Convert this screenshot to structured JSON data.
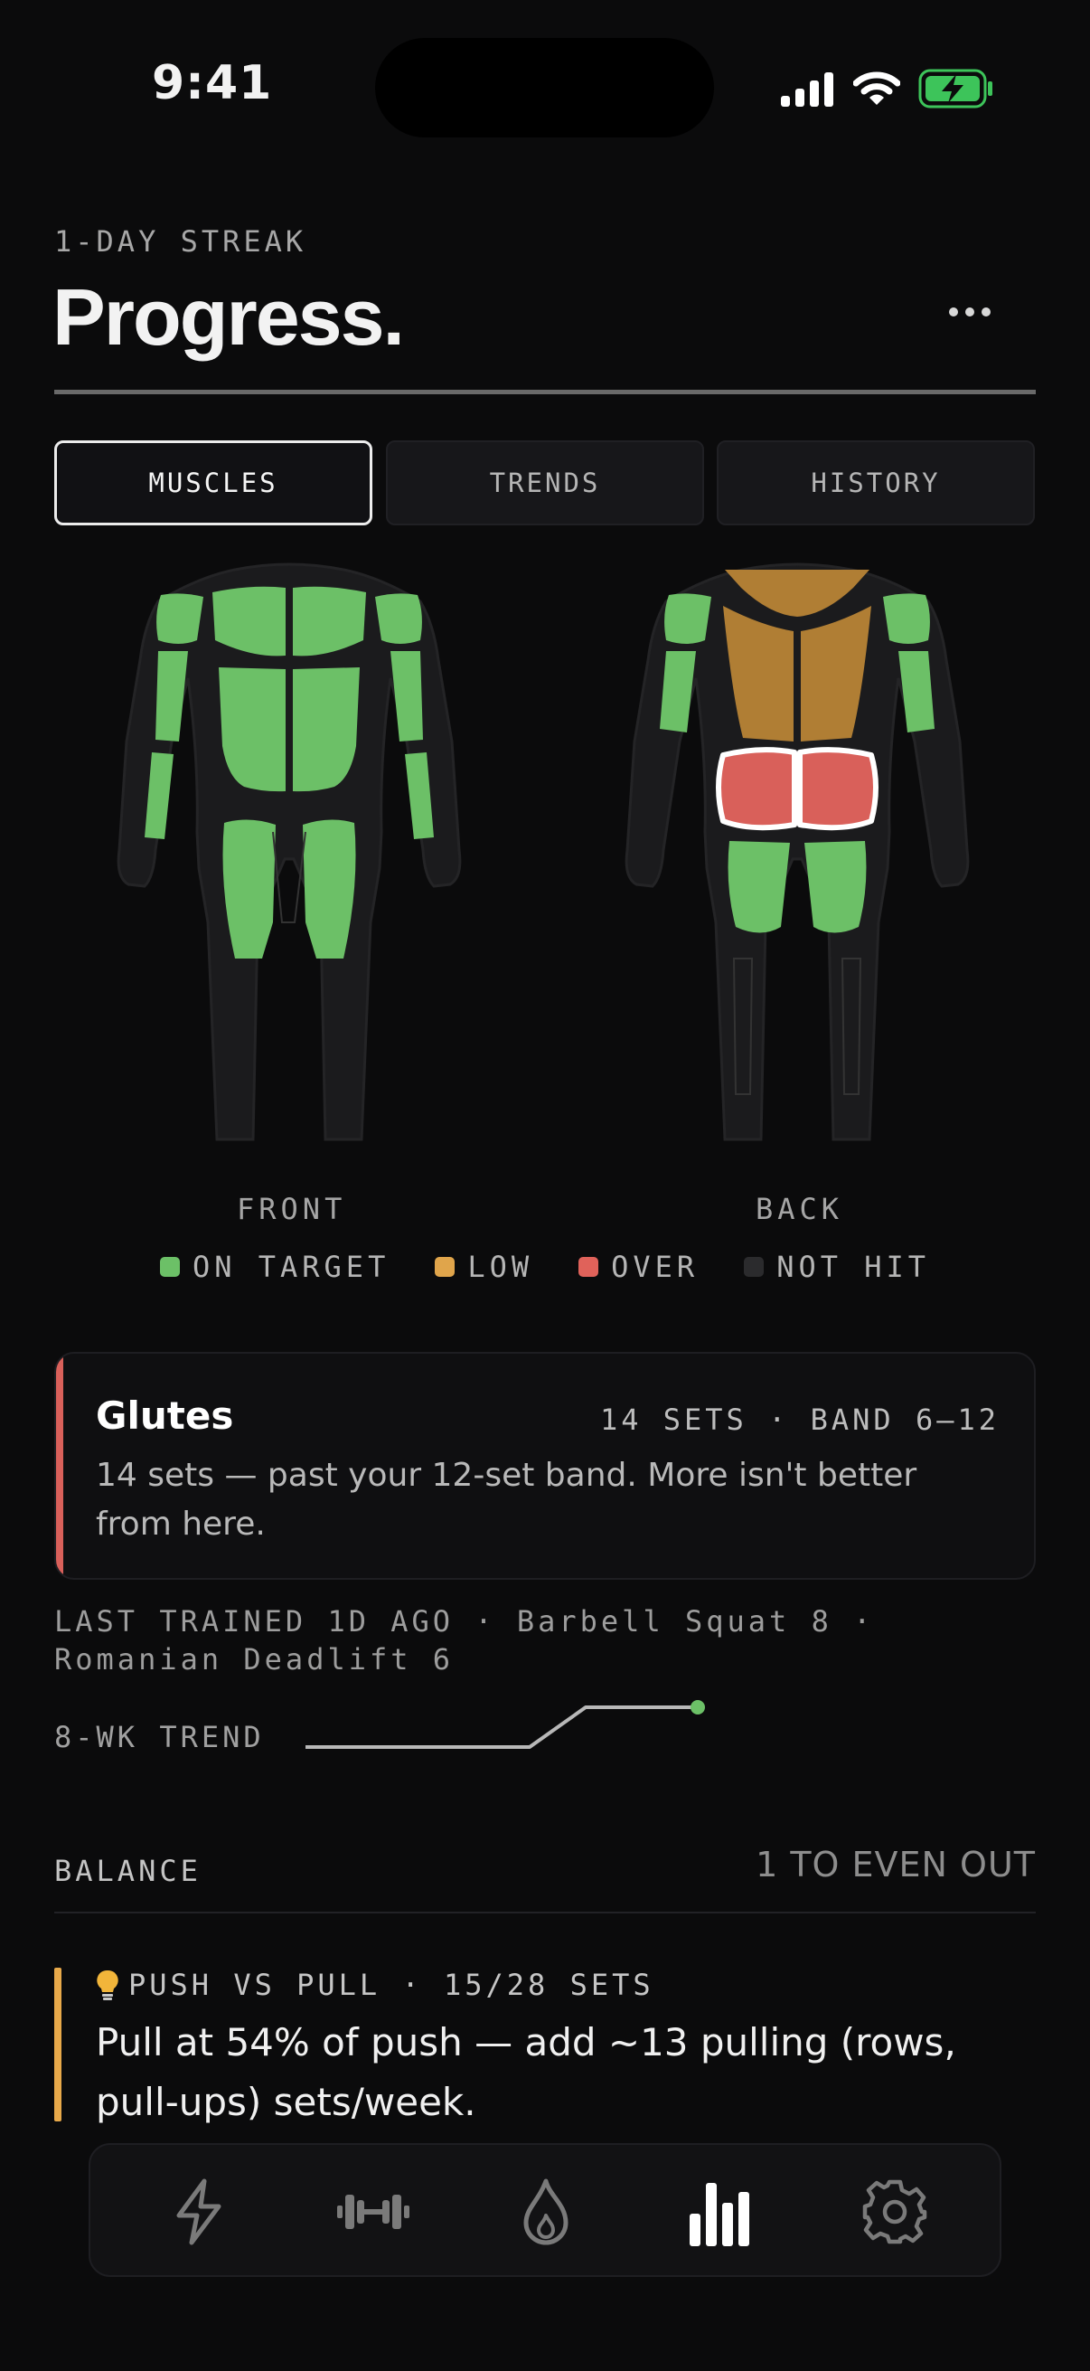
{
  "status": {
    "time": "9:41"
  },
  "header": {
    "streak": "1-DAY STREAK",
    "title": "Progress."
  },
  "tabs": [
    {
      "label": "MUSCLES",
      "active": true
    },
    {
      "label": "TRENDS",
      "active": false
    },
    {
      "label": "HISTORY",
      "active": false
    }
  ],
  "figures": {
    "front_label": "FRONT",
    "back_label": "BACK"
  },
  "legend": [
    {
      "label": "ON TARGET",
      "color": "#6cc067"
    },
    {
      "label": "LOW",
      "color": "#e0a54b"
    },
    {
      "label": "OVER",
      "color": "#e0625a"
    },
    {
      "label": "NOT HIT",
      "color": "#2b2b2d"
    }
  ],
  "colors": {
    "on_target": "#6cc067",
    "low": "#b07e34",
    "over": "#d9605a",
    "not_hit": "#1d1d1f",
    "accent_tip": "#e8a94a"
  },
  "muscle_card": {
    "name": "Glutes",
    "meta": "14 SETS · BAND 6–12",
    "description": "14 sets — past your 12-set band. More isn't better from here.",
    "status": "over"
  },
  "last_trained": "LAST TRAINED 1D AGO  ·  Barbell Squat 8 · Romanian Deadlift 6",
  "trend": {
    "label": "8-WK TREND",
    "values": [
      0,
      0,
      0,
      0,
      0,
      14,
      14,
      14
    ]
  },
  "balance": {
    "label": "BALANCE",
    "summary": "1 TO EVEN OUT"
  },
  "tip": {
    "icon": "lightbulb-icon",
    "heading": "PUSH VS PULL · 15/28 SETS",
    "body": "Pull at 54% of push — add ~13 pulling (rows, pull-ups) sets/week."
  },
  "nav": [
    {
      "icon": "bolt-icon",
      "active": false
    },
    {
      "icon": "dumbbell-icon",
      "active": false
    },
    {
      "icon": "flame-icon",
      "active": false
    },
    {
      "icon": "bar-chart-icon",
      "active": true
    },
    {
      "icon": "gear-icon",
      "active": false
    }
  ]
}
